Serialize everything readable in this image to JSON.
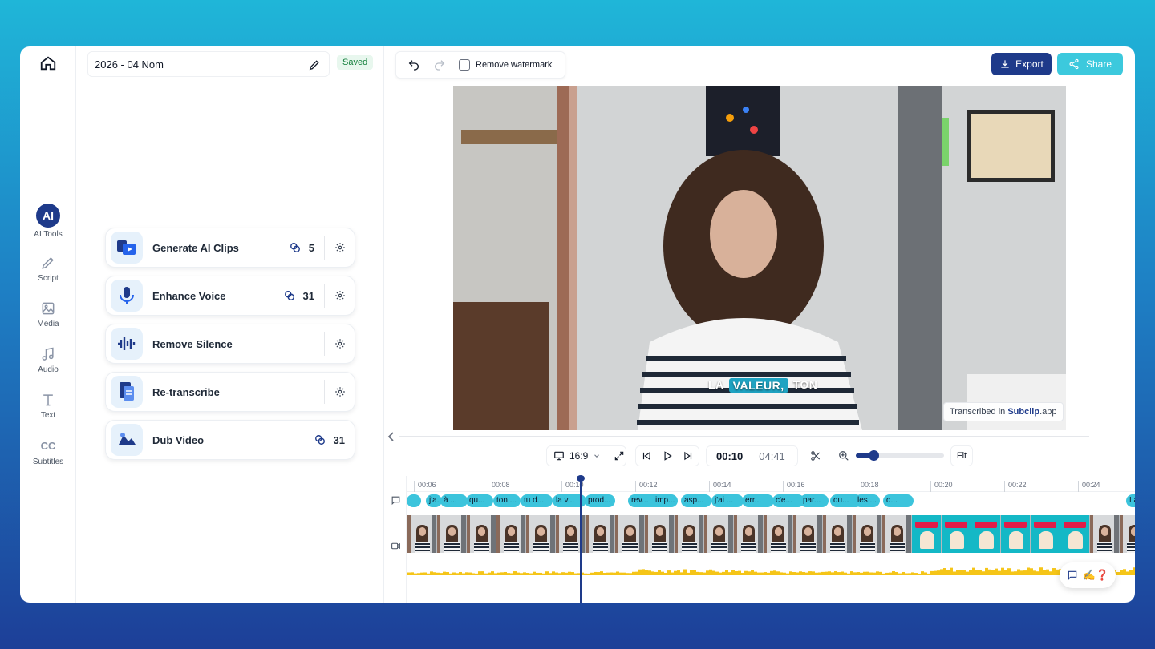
{
  "project": {
    "title": "2026 - 04 Nom",
    "status": "Saved"
  },
  "rail": [
    {
      "label": "AI Tools",
      "badge": "AI"
    },
    {
      "label": "Script"
    },
    {
      "label": "Media"
    },
    {
      "label": "Audio"
    },
    {
      "label": "Text"
    },
    {
      "label": "Subtitles",
      "badge": "CC"
    }
  ],
  "tools": [
    {
      "label": "Generate AI Clips",
      "credits": "5"
    },
    {
      "label": "Enhance Voice",
      "credits": "31"
    },
    {
      "label": "Remove Silence",
      "credits": ""
    },
    {
      "label": "Re-transcribe",
      "credits": ""
    },
    {
      "label": "Dub Video",
      "credits": "31"
    }
  ],
  "toolbar": {
    "watermark_label": "Remove watermark",
    "export_label": "Export",
    "share_label": "Share"
  },
  "video": {
    "caption_words": [
      "LA",
      "VALEUR,",
      "TON"
    ],
    "watermark_prefix": "Transcribed in ",
    "watermark_brand": "Subclip",
    "watermark_suffix": ".app"
  },
  "controls": {
    "aspect": "16:9",
    "current_time": "00:10",
    "total_time": "04:41",
    "fit_label": "Fit",
    "zoom_level": 0.2
  },
  "timeline": {
    "ticks": [
      "00:06",
      "00:08",
      "00:10",
      "00:12",
      "00:14",
      "00:16",
      "00:18",
      "00:20",
      "00:22",
      "00:24"
    ],
    "subtitles": [
      "j'a...",
      "à ...",
      "qu...",
      "ton ...",
      "tu d...",
      "la v...",
      "prod...",
      "rev...",
      "imp...",
      "asp...",
      "j'ai ...",
      "err...",
      "c'e...",
      "par...",
      "qu...",
      "les ...",
      "q...",
      "La p..."
    ],
    "float_icons": "✍️❓"
  },
  "colors": {
    "accent": "#1e3a8a",
    "cyan": "#3cc9dd",
    "audio": "#f5c518"
  }
}
